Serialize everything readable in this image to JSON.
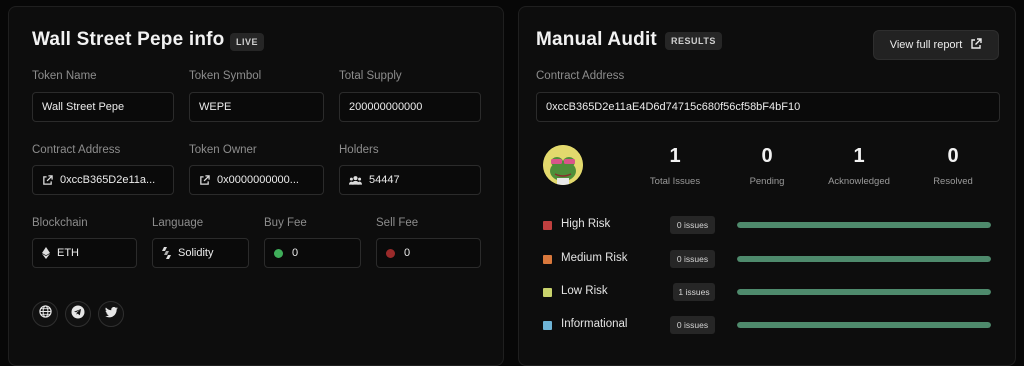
{
  "info": {
    "title": "Wall Street Pepe info",
    "badge": "LIVE",
    "token_name": {
      "label": "Token Name",
      "value": "Wall Street Pepe"
    },
    "token_symbol": {
      "label": "Token Symbol",
      "value": "WEPE"
    },
    "total_supply": {
      "label": "Total Supply",
      "value": "200000000000"
    },
    "contract_address": {
      "label": "Contract Address",
      "value": "0xccB365D2e11a..."
    },
    "token_owner": {
      "label": "Token Owner",
      "value": "0x0000000000..."
    },
    "holders": {
      "label": "Holders",
      "value": "54447"
    },
    "blockchain": {
      "label": "Blockchain",
      "value": "ETH"
    },
    "language": {
      "label": "Language",
      "value": "Solidity"
    },
    "buy_fee": {
      "label": "Buy Fee",
      "value": "0",
      "color": "#3fae5a"
    },
    "sell_fee": {
      "label": "Sell Fee",
      "value": "0",
      "color": "#9a2a2a"
    },
    "socials": [
      "globe-icon",
      "telegram-icon",
      "twitter-icon"
    ]
  },
  "audit": {
    "title": "Manual Audit",
    "badge": "RESULTS",
    "button_label": "View full report",
    "contract_label": "Contract Address",
    "contract_value": "0xccB365D2e11aE4D6d74715c680f56cf58bF4bF10",
    "stats": [
      {
        "value": "1",
        "label": "Total Issues"
      },
      {
        "value": "0",
        "label": "Pending"
      },
      {
        "value": "1",
        "label": "Acknowledged"
      },
      {
        "value": "0",
        "label": "Resolved"
      }
    ],
    "risks": [
      {
        "name": "High Risk",
        "count": "0 issues",
        "color": "#c0403f",
        "progress": 1.0
      },
      {
        "name": "Medium Risk",
        "count": "0 issues",
        "color": "#d9783c",
        "progress": 1.0
      },
      {
        "name": "Low Risk",
        "count": "1 issues",
        "color": "#c9d36c",
        "progress": 1.0
      },
      {
        "name": "Informational",
        "count": "0 issues",
        "color": "#6fb4d6",
        "progress": 1.0
      }
    ]
  }
}
